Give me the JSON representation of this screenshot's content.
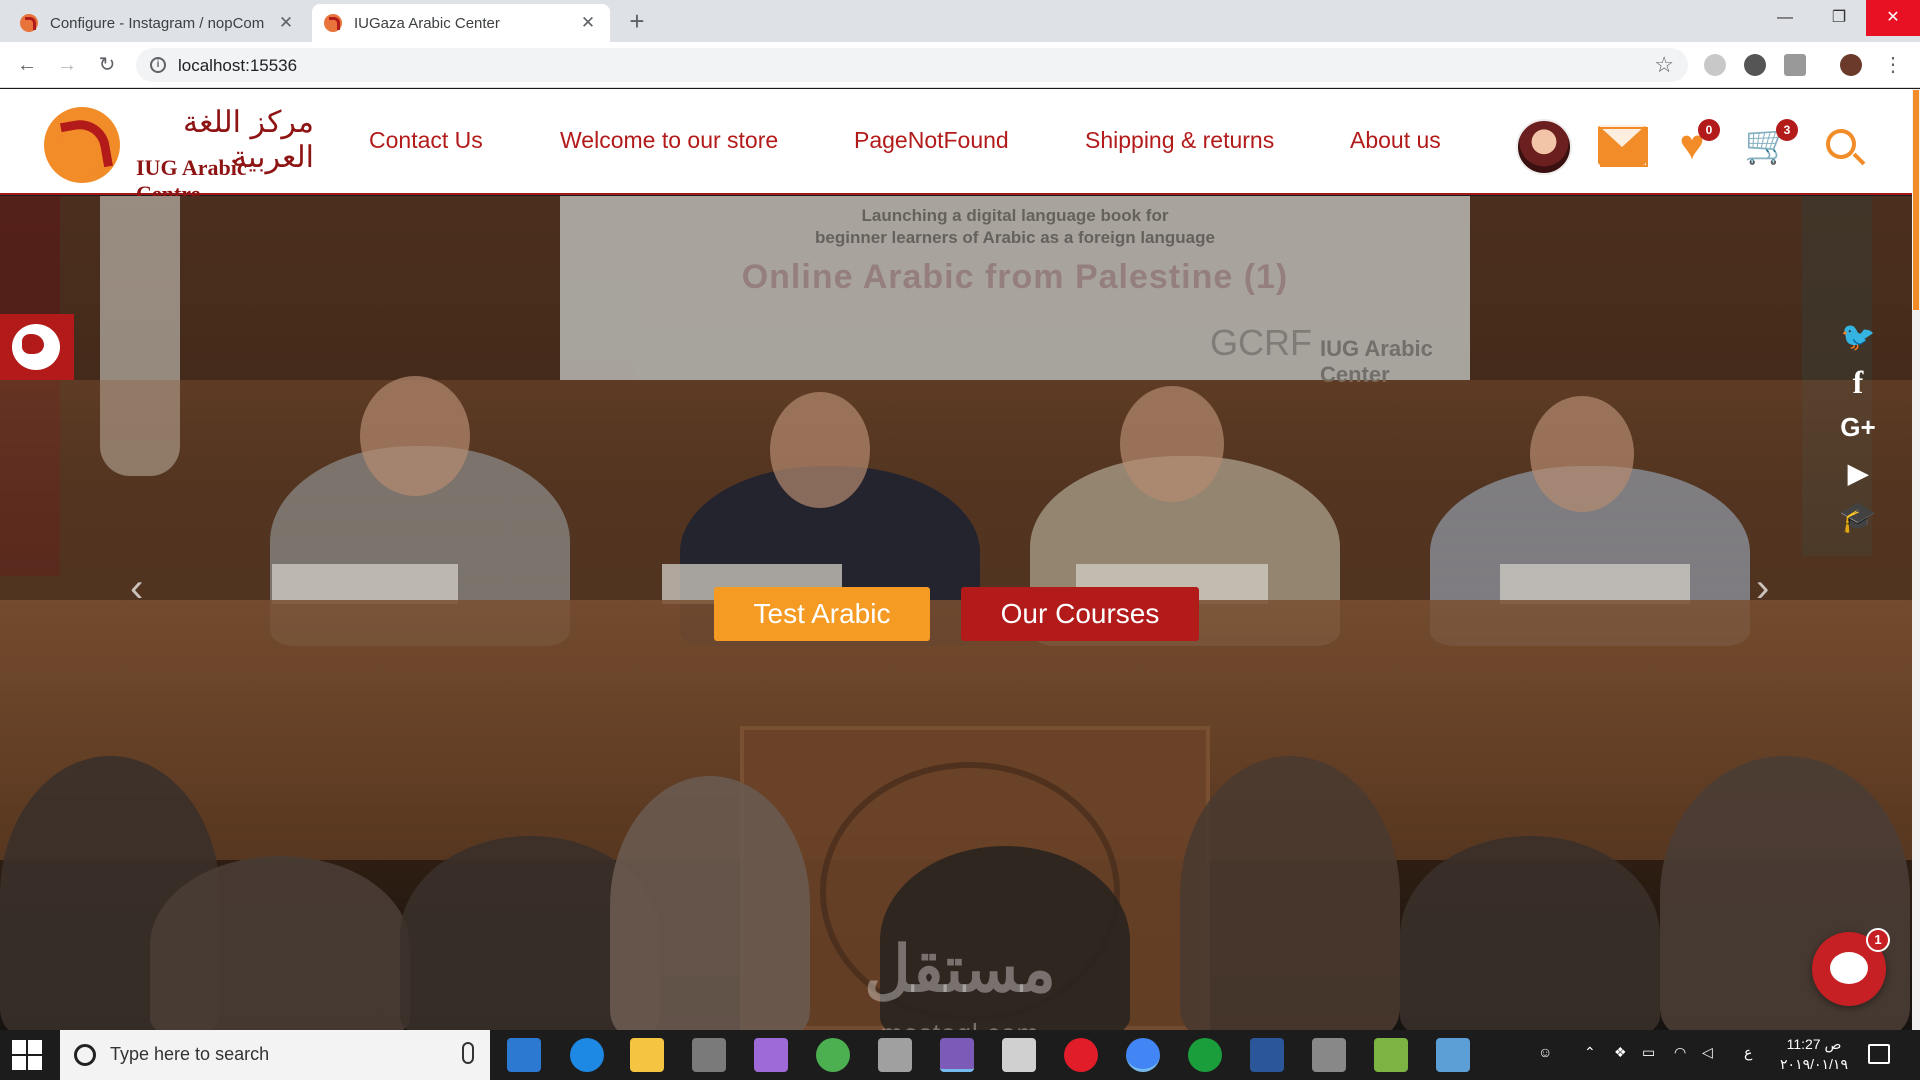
{
  "browser": {
    "tabs": [
      {
        "title": "Configure - Instagram / nopCom",
        "active": false
      },
      {
        "title": "IUGaza Arabic Center",
        "active": true
      }
    ],
    "new_tab_label": "+",
    "url": "localhost:15536",
    "window_controls": {
      "minimize": "—",
      "maximize": "❐",
      "close": "✕"
    }
  },
  "site": {
    "logo_arabic": "مركز اللغة العربية",
    "logo_english": "IUG Arabic Centre",
    "nav": [
      "Contact Us",
      "Welcome to our store",
      "PageNotFound",
      "Shipping & returns",
      "About us"
    ],
    "wishlist_count": "0",
    "cart_count": "3"
  },
  "hero": {
    "banner_line1": "Launching a digital language book for",
    "banner_line2": "beginner learners of Arabic as a foreign language",
    "banner_title": "Online Arabic from Palestine (1)",
    "banner_gcrf": "GCRF",
    "banner_iug": "IUG Arabic Center",
    "buttons": {
      "test": "Test Arabic",
      "courses": "Our Courses"
    },
    "prev_arrow": "‹",
    "next_arrow": "›",
    "social": [
      "twitter-icon",
      "facebook-icon",
      "google-plus-icon",
      "youtube-icon",
      "graduation-cap-icon"
    ],
    "chat_badge": "1"
  },
  "watermark": {
    "arabic": "مستقل",
    "latin": "mostaql.com"
  },
  "taskbar": {
    "search_placeholder": "Type here to search",
    "clock_time": "11:27 ص",
    "clock_date": "٢٠١٩/٠١/١٩",
    "lang": "ع"
  },
  "colors": {
    "brand_red": "#b31b1b",
    "brand_orange": "#f28c28",
    "button_orange": "#f59a23"
  }
}
